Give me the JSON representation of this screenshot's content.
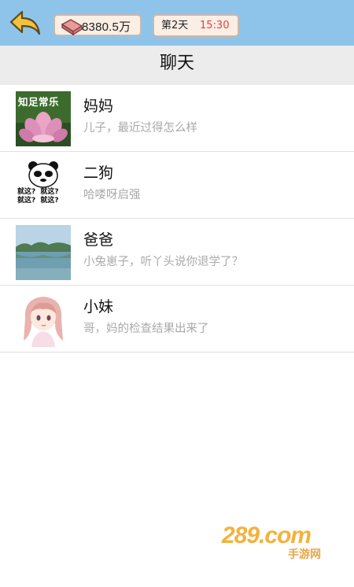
{
  "header": {
    "money": "8380.5万",
    "day": "第2天",
    "time": "15:30"
  },
  "page": {
    "title": "聊天"
  },
  "chats": [
    {
      "name": "妈妈",
      "preview": "儿子，最近过得怎么样",
      "avatar_text": "知足常乐"
    },
    {
      "name": "二狗",
      "preview": "哈喽呀启强",
      "avatar_text": [
        "就这?",
        "就这?",
        "就这?",
        "就这?"
      ]
    },
    {
      "name": "爸爸",
      "preview": "小兔崽子，听丫头说你退学了？"
    },
    {
      "name": "小妹",
      "preview": "哥，妈的检查结果出来了"
    }
  ],
  "watermark": {
    "text": "289.com",
    "sub": "手游网"
  },
  "colors": {
    "topbar": "#8fc4ea",
    "titlebar": "#ececec",
    "time": "#e24141",
    "preview": "#a9a9a9"
  }
}
